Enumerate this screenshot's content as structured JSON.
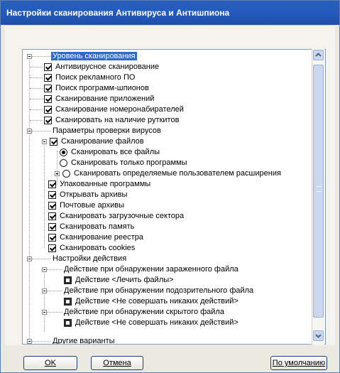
{
  "window": {
    "title": "Настройки сканирования Антивируса и Антишпиона"
  },
  "tree": {
    "group_scan_level": "Уровень сканирования",
    "scan_level_items": [
      "Антивирусное сканирование",
      "Поиск рекламного ПО",
      "Поиск программ-шпионов",
      "Сканирование приложений",
      "Сканирование номеронабирателей",
      "Сканировать на наличие руткитов"
    ],
    "group_virus": "Параметры проверки вирусов",
    "file_scan": "Сканирование файлов",
    "radios": [
      "Сканировать все файлы",
      "Сканировать только программы",
      "Сканировать определяемые пользователем расширения"
    ],
    "virus_items": [
      "Упакованные программы",
      "Открывать архивы",
      "Почтовые архивы",
      "Сканировать загрузочные сектора",
      "Сканировать память",
      "Сканирование реестра",
      "Сканировать cookies"
    ],
    "group_actions": "Настройки действия",
    "infected": "Действие при обнаружении зараженного файла",
    "infected_action": "Действие <Лечить файлы>",
    "suspicious": "Действие при обнаружении подозрительного файла",
    "suspicious_action": "Действие <Не совершать никаких действий>",
    "hidden": "Действие при обнаружении скрытого файла",
    "hidden_action": "Действие <Не совершать никаких действий>",
    "group_other": "Другие варианты"
  },
  "buttons": {
    "ok": "OK",
    "cancel": "Отмена",
    "defaults": "По умолчанию"
  },
  "colors": {
    "titlebar": "#235bbf",
    "selection": "#316ac5"
  },
  "icons": {
    "expand": "minus-box",
    "collapse": "plus-box",
    "check": "check-mark",
    "scroll_up": "chevron-up",
    "scroll_down": "chevron-down"
  }
}
